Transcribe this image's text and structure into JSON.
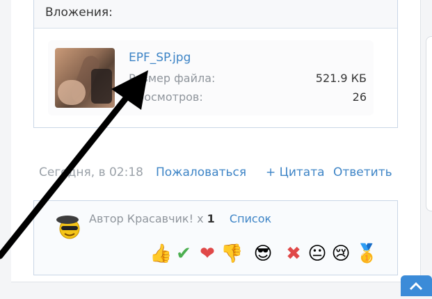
{
  "attachments": {
    "title": "Вложения:",
    "file": {
      "name": "EPF_SP.jpg",
      "size_label": "Размер файла:",
      "size_value": "521.9 КБ",
      "views_label": "Просмотров:",
      "views_value": "26"
    }
  },
  "post_footer": {
    "date": "Сегодня, в 02:18",
    "report": "Пожаловаться",
    "quote": "+ Цитата",
    "reply": "Ответить"
  },
  "reactions": {
    "label": "Автор Красавчик! x",
    "count": "1",
    "list_link": "Список",
    "emoji": [
      "👍",
      "✔",
      "❤",
      "👎",
      "😎",
      "✖",
      "😐",
      "😢",
      "🥇"
    ]
  },
  "colors": {
    "link": "#3d84c6",
    "muted": "#8f959c",
    "border": "#c9d6e6",
    "scroll_button": "#3b8bd8"
  }
}
